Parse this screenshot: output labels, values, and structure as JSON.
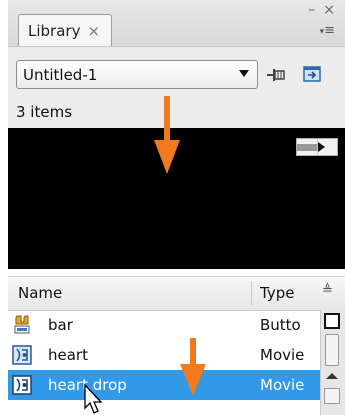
{
  "panel": {
    "tab_label": "Library",
    "tab_close": "×",
    "window_controls": {
      "minimize": "–",
      "close": "×"
    },
    "panel_menu_icon": "panel-menu-icon"
  },
  "toolbar": {
    "document_dropdown_value": "Untitled-1",
    "pin_icon": "pin-library-icon",
    "new_library_panel_icon": "new-library-panel-icon"
  },
  "item_count": "3 items",
  "preview": {
    "stop_icon": "stop-icon",
    "play_icon": "play-icon"
  },
  "list": {
    "columns": {
      "name": "Name",
      "type": "Type"
    },
    "sort_icon": "≜",
    "rows": [
      {
        "name": "bar",
        "type": "Butto",
        "icon": "button-symbol-icon",
        "selected": false
      },
      {
        "name": "heart",
        "type": "Movie",
        "icon": "movieclip-symbol-icon",
        "selected": false
      },
      {
        "name": "heart drop",
        "type": "Movie",
        "icon": "movieclip-symbol-icon",
        "selected": true
      }
    ]
  },
  "colors": {
    "selection": "#3298e8",
    "annotation_arrow": "#f07a1e",
    "preview_bg": "#000000"
  }
}
